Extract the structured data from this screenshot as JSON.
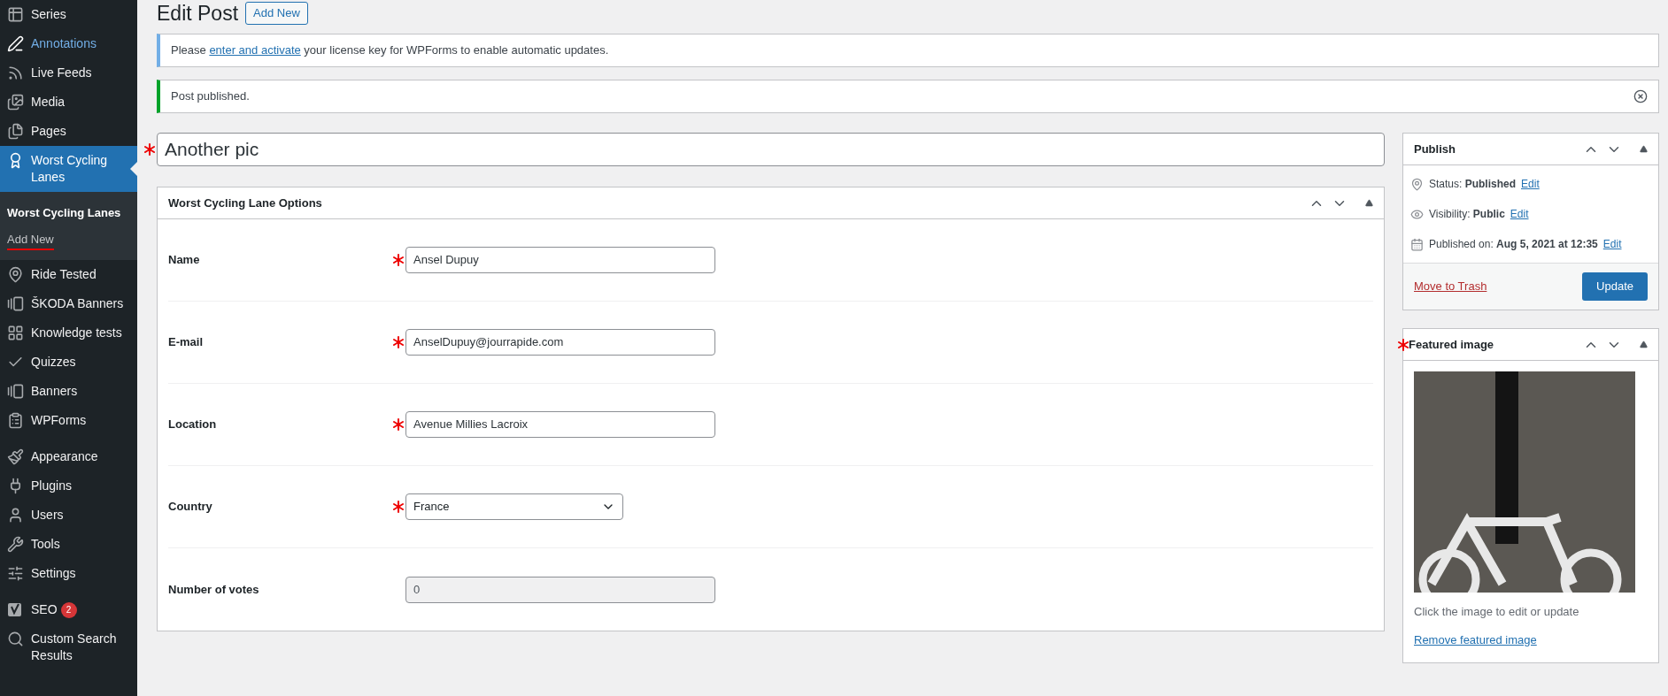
{
  "sidebar": {
    "groups": [
      {
        "items": [
          {
            "label": "Series",
            "selected": false,
            "highlighted": false
          },
          {
            "label": "Annotations",
            "selected": false,
            "highlighted": true
          },
          {
            "label": "Live Feeds",
            "selected": false,
            "highlighted": false
          },
          {
            "label": "Media",
            "selected": false,
            "highlighted": false
          },
          {
            "label": "Pages",
            "selected": false,
            "highlighted": false
          },
          {
            "label": "Worst Cycling Lanes",
            "selected": true,
            "highlighted": false,
            "children": [
              {
                "label": "Worst Cycling Lanes",
                "selected": true,
                "annotated": false
              },
              {
                "label": "Add New",
                "selected": false,
                "annotated": true
              }
            ]
          },
          {
            "label": "Ride Tested",
            "selected": false,
            "highlighted": false
          },
          {
            "label": "ŠKODA Banners",
            "selected": false,
            "highlighted": false
          },
          {
            "label": "Knowledge tests",
            "selected": false,
            "highlighted": false
          },
          {
            "label": "Quizzes",
            "selected": false,
            "highlighted": false
          },
          {
            "label": "Banners",
            "selected": false,
            "highlighted": false
          },
          {
            "label": "WPForms",
            "selected": false,
            "highlighted": false
          }
        ]
      },
      {
        "items": [
          {
            "label": "Appearance",
            "selected": false,
            "highlighted": false
          },
          {
            "label": "Plugins",
            "selected": false,
            "highlighted": false
          },
          {
            "label": "Users",
            "selected": false,
            "highlighted": false
          },
          {
            "label": "Tools",
            "selected": false,
            "highlighted": false
          },
          {
            "label": "Settings",
            "selected": false,
            "highlighted": false
          }
        ]
      },
      {
        "items": [
          {
            "label": "SEO",
            "selected": false,
            "highlighted": false,
            "badge": "2"
          },
          {
            "label": "Custom Search Results",
            "selected": false,
            "highlighted": false
          }
        ]
      }
    ]
  },
  "header": {
    "title": "Edit Post",
    "button": "Add New"
  },
  "notices": [
    {
      "kind": "info",
      "parts": [
        "Please ",
        "enter and activate",
        " your license key for WPForms to enable automatic updates."
      ]
    },
    {
      "kind": "success",
      "parts": [
        "Post published."
      ]
    }
  ],
  "post_title": {
    "value": "Another pic",
    "annotated": true
  },
  "options_box": {
    "title": "Worst Cycling Lane Options",
    "fields": [
      {
        "label": "Name",
        "kind": "text",
        "value": "Ansel Dupuy",
        "annotated": true
      },
      {
        "label": "E-mail",
        "kind": "text",
        "value": "AnselDupuy@jourrapide.com",
        "annotated": true
      },
      {
        "label": "Location",
        "kind": "text",
        "value": "Avenue Millies Lacroix",
        "annotated": true
      },
      {
        "label": "Country",
        "kind": "select",
        "value": "France",
        "annotated": true
      },
      {
        "label": "Number of votes",
        "kind": "readonly",
        "value": "0",
        "annotated": false
      }
    ]
  },
  "publish_box": {
    "title": "Publish",
    "rows": [
      {
        "label": "Status: ",
        "value": "Published",
        "link": "Edit"
      },
      {
        "label": "Visibility: ",
        "value": "Public",
        "link": "Edit"
      },
      {
        "label": "Published on: ",
        "value": "Aug 5, 2021 at 12:35",
        "link": "Edit"
      }
    ],
    "trash": "Move to Trash",
    "button": "Update"
  },
  "featured_box": {
    "title": "Featured image",
    "annotated": true,
    "hint": "Click the image to edit or update",
    "remove": "Remove featured image"
  }
}
